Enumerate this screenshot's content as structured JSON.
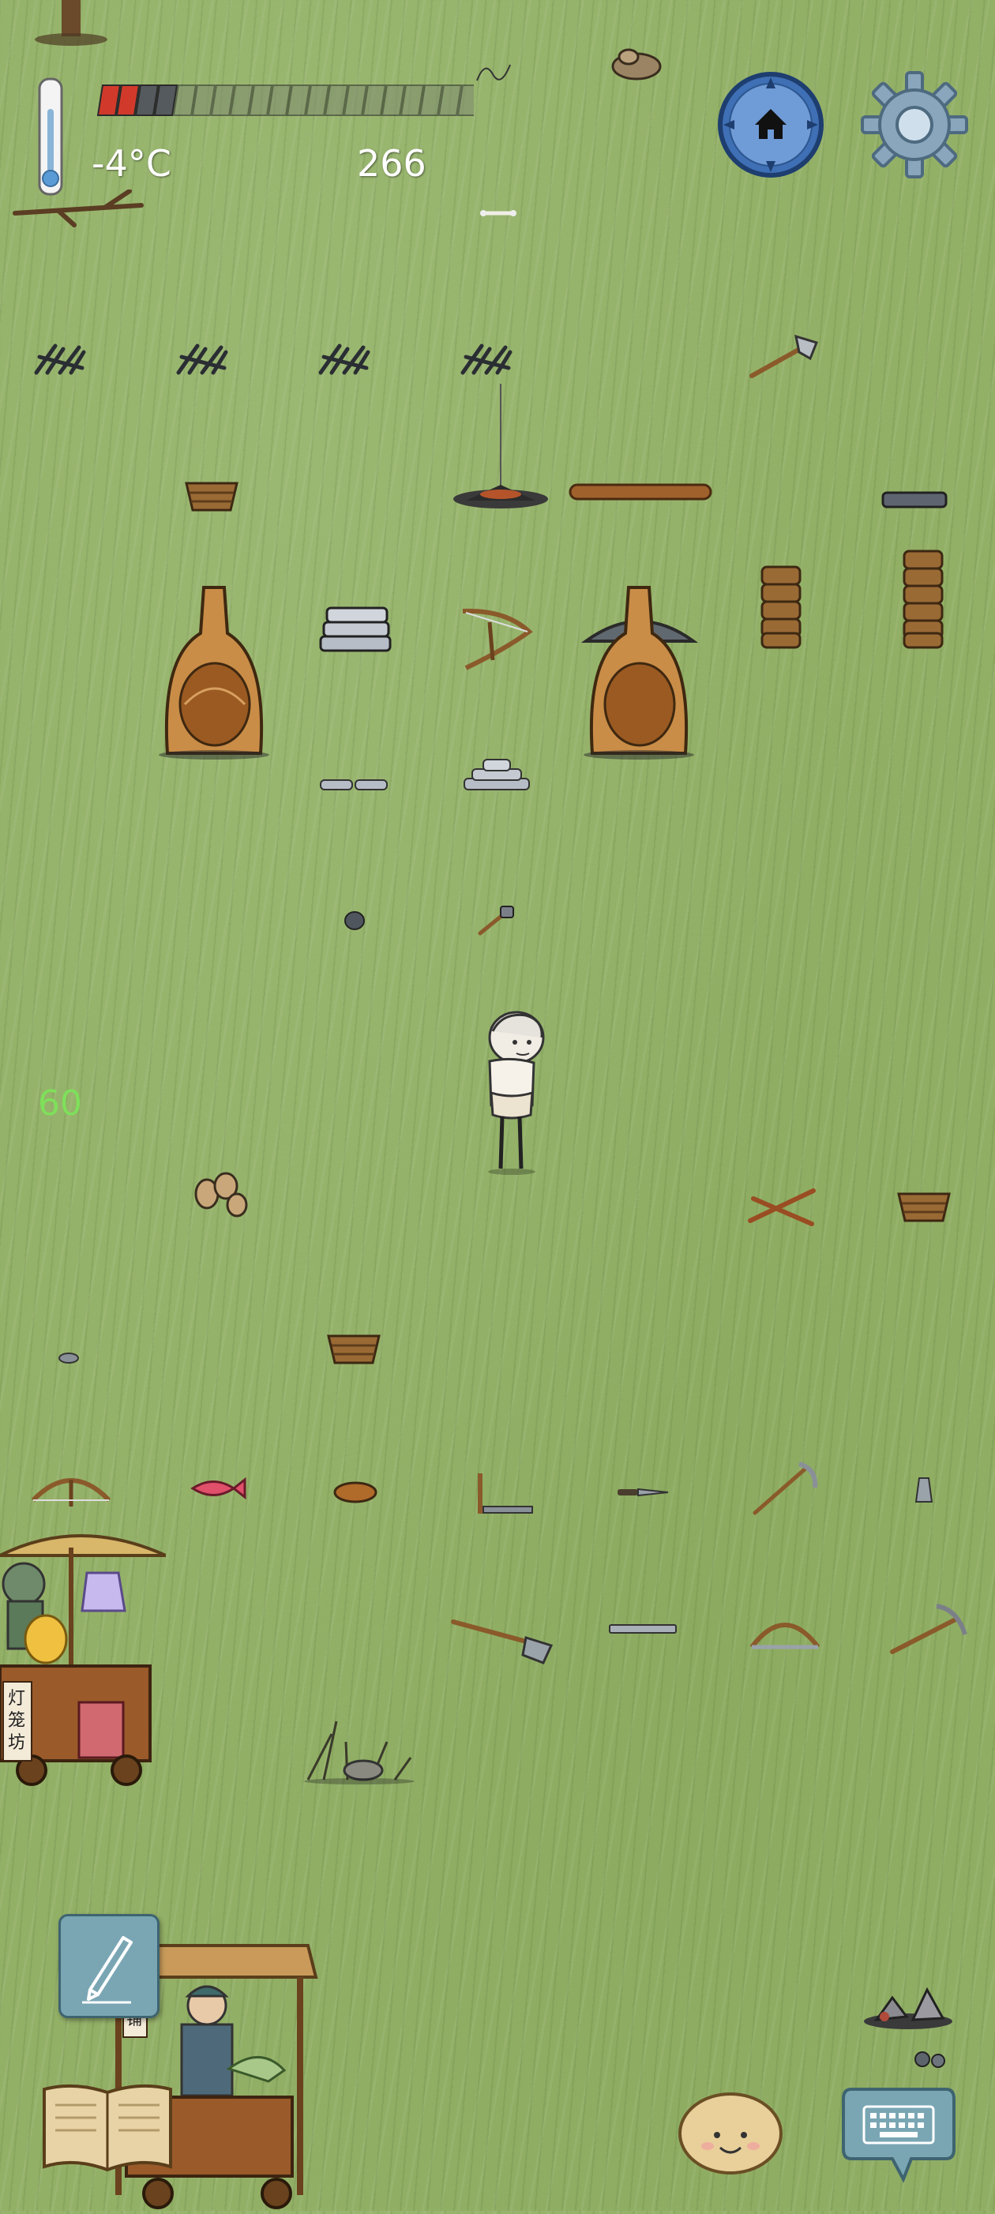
{
  "hud": {
    "temperature": "-4°C",
    "counter": "266",
    "side_number": "60",
    "side_number_color": "#7ee05a",
    "hunger_pips_filled": 2,
    "hunger_pips_total": 20,
    "hunger_color": "#d13a2a"
  },
  "buttons": {
    "home_icon": "house-icon",
    "settings_icon": "gear-icon",
    "edit_icon": "pencil-icon",
    "recipe_book_icon": "open-book-icon",
    "emote_icon": "smiling-face-icon",
    "keyboard_icon": "keyboard-icon"
  },
  "stalls": {
    "lantern_stall_sign": "灯笼坊",
    "goods_stall_sign": "货铺"
  }
}
